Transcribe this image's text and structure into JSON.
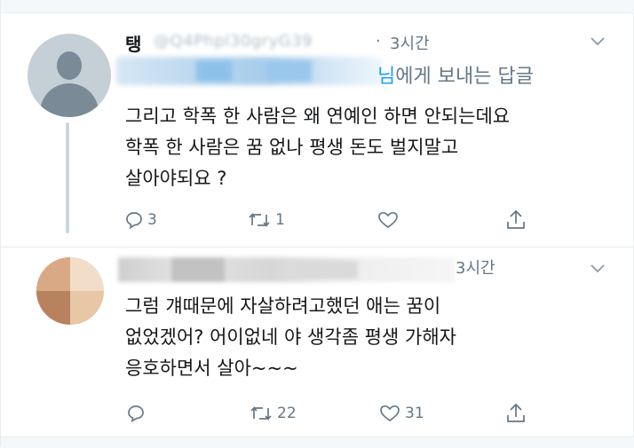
{
  "tweet1": {
    "username": "탱",
    "handle": "@Q4Phpl30gryG39",
    "dot": "·",
    "time": "3시간",
    "reply_to_prefix": "님에게 보내는 답글",
    "reply_to_mention": "님",
    "reply_to_suffix": "에게 보내는 답글",
    "text_lines": [
      "그리고 학폭 한 사람은 왜 연예인 하면 안되는데요",
      "학폭 한 사람은 꿈 없나 평생 돈도 벌지말고",
      "살아야되요 ?"
    ],
    "reply_count": "3",
    "retweet_count": "1",
    "like_count": ""
  },
  "tweet2": {
    "time": "3시간",
    "text_lines": [
      "그럼 걔때문에 자살하려고했던 애는 꿈이",
      "없었겠어? 어이없네 야 생각좀 평생 가해자",
      "응호하면서 살아~~~"
    ],
    "reply_count": "",
    "retweet_count": "22",
    "like_count": "31"
  },
  "colors": {
    "accent": "#1da1f2",
    "secondary_text": "#657786",
    "primary_text": "#14171a",
    "divider": "#e6ecf0"
  },
  "icons": [
    "reply-icon",
    "retweet-icon",
    "like-icon",
    "share-icon",
    "chevron-down-icon",
    "default-avatar-icon"
  ]
}
